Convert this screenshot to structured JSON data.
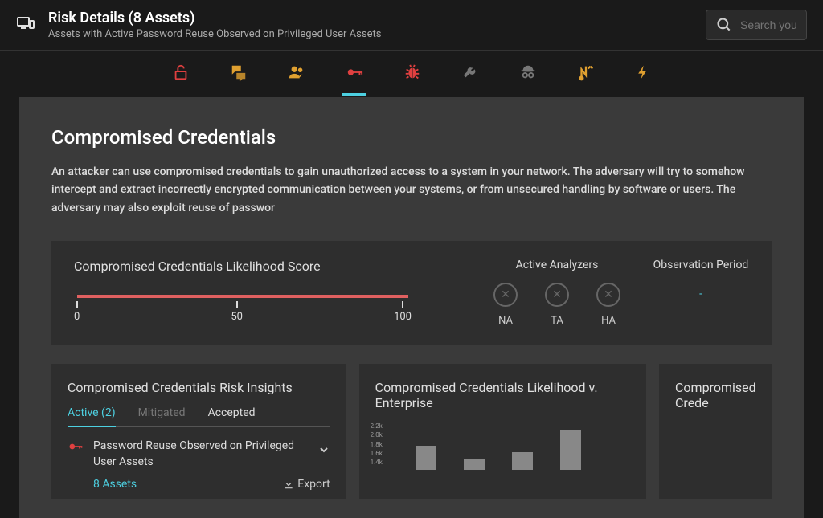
{
  "header": {
    "title": "Risk Details (8 Assets)",
    "subtitle": "Assets with Active Password Reuse Observed on Privileged User Assets",
    "search_placeholder": "Search your"
  },
  "section": {
    "title": "Compromised Credentials",
    "description": "An attacker can use compromised credentials to gain unauthorized access to a system in your network. The adversary will try to somehow intercept and extract incorrectly encrypted communication between your systems, or from unsecured handling by software or users. The adversary may also exploit reuse of passwor"
  },
  "score": {
    "title": "Compromised Credentials Likelihood Score",
    "min": "0",
    "mid": "50",
    "max": "100"
  },
  "analyzers": {
    "title": "Active Analyzers",
    "items": [
      {
        "label": "NA"
      },
      {
        "label": "TA"
      },
      {
        "label": "HA"
      }
    ]
  },
  "observation": {
    "title": "Observation Period",
    "value": "-"
  },
  "insights": {
    "title": "Compromised Credentials Risk Insights",
    "tabs": {
      "active": "Active (2)",
      "mitigated": "Mitigated",
      "accepted": "Accepted"
    },
    "item": {
      "text": "Password Reuse Observed on Privileged User Assets",
      "assets": "8 Assets",
      "export": "Export"
    }
  },
  "likelihood": {
    "title": "Compromised Credentials Likelihood v. Enterprise"
  },
  "panel3": {
    "title": "Compromised Crede"
  },
  "chart_data": {
    "type": "bar",
    "ylabels": [
      "2.2k",
      "2.0k",
      "1.8k",
      "1.6k",
      "1.4k"
    ],
    "values": [
      1700,
      1500,
      1600,
      2100
    ]
  }
}
